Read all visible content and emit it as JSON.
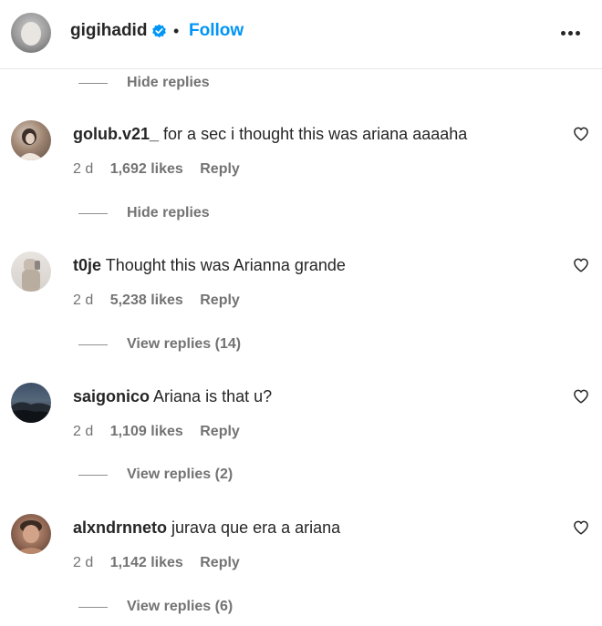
{
  "header": {
    "username": "gigihadid",
    "separator": "•",
    "follow_label": "Follow",
    "icons": {
      "verified": "verified-badge-icon",
      "more": "more-options-icon"
    },
    "colors": {
      "follow": "#0095f6",
      "verified": "#0095f6"
    }
  },
  "top_toggle": {
    "label": "Hide replies"
  },
  "comments": [
    {
      "username": "golub.v21_",
      "text": "for a sec i thought this was ariana aaaaha",
      "time": "2 d",
      "likes": "1,692 likes",
      "reply_label": "Reply",
      "replies_toggle": "Hide replies"
    },
    {
      "username": "t0je",
      "text": "Thought this was Arianna grande",
      "time": "2 d",
      "likes": "5,238 likes",
      "reply_label": "Reply",
      "replies_toggle": "View replies (14)"
    },
    {
      "username": "saigonico",
      "text": "Ariana is that u?",
      "time": "2 d",
      "likes": "1,109 likes",
      "reply_label": "Reply",
      "replies_toggle": "View replies (2)"
    },
    {
      "username": "alxndrnneto",
      "text": "jurava que era a ariana",
      "time": "2 d",
      "likes": "1,142 likes",
      "reply_label": "Reply",
      "replies_toggle": "View replies (6)"
    }
  ]
}
